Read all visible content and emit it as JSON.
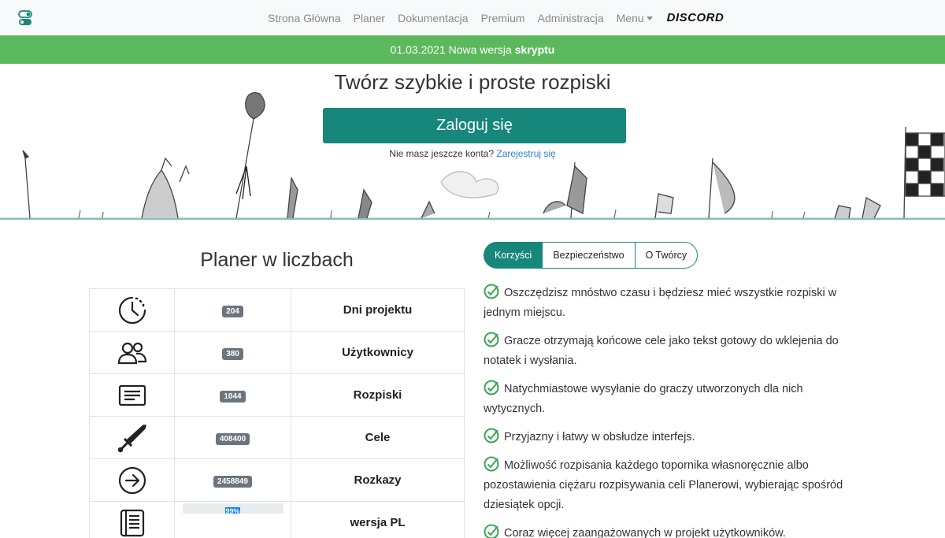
{
  "nav": {
    "links": [
      "Strona Główna",
      "Planer",
      "Dokumentacja",
      "Premium",
      "Administracja"
    ],
    "menu_label": "Menu",
    "discord_label": "DISCORD"
  },
  "banner": {
    "date": "01.03.2021",
    "text": "Nowa wersja",
    "highlight": "skryptu"
  },
  "hero": {
    "title": "Twórz szybkie i proste rozpiski",
    "login_label": "Zaloguj się",
    "register_prompt": "Nie masz jeszcze konta?",
    "register_link": "Zarejestruj się"
  },
  "stats": {
    "title": "Planer w liczbach",
    "rows": [
      {
        "icon": "clock-icon",
        "value": "204",
        "label": "Dni projektu"
      },
      {
        "icon": "users-icon",
        "value": "380",
        "label": "Użytkownicy"
      },
      {
        "icon": "document-icon",
        "value": "1044",
        "label": "Rozpiski"
      },
      {
        "icon": "sword-icon",
        "value": "408400",
        "label": "Cele"
      },
      {
        "icon": "arrow-circle-icon",
        "value": "2458849",
        "label": "Rozkazy"
      },
      {
        "icon": "book-icon",
        "value": "99%",
        "progress": 0.99,
        "label": "wersja PL"
      }
    ]
  },
  "tabs": [
    "Korzyści",
    "Bezpieczeństwo",
    "O Twórcy"
  ],
  "benefits": [
    "Oszczędzisz mnóstwo czasu i będziesz mieć wszystkie rozpiski w jednym miejscu.",
    "Gracze otrzymają końcowe cele jako tekst gotowy do wklejenia do notatek i wysłania.",
    "Natychmiastowe wysyłanie do graczy utworzonych dla nich wytycznych.",
    "Przyjazny i łatwy w obsłudze interfejs.",
    "Możliwość rozpisania każdego topornika własnoręcznie albo pozostawienia ciężaru rozpisywania celi Planerowi, wybierając spośród dziesiątek opcji.",
    "Coraz więcej zaangażowanych w projekt użytkowników."
  ],
  "colors": {
    "brand_teal": "#17877c",
    "banner_green": "#5cb85c",
    "progress_blue": "#007bff",
    "check_green": "#3aa655"
  }
}
